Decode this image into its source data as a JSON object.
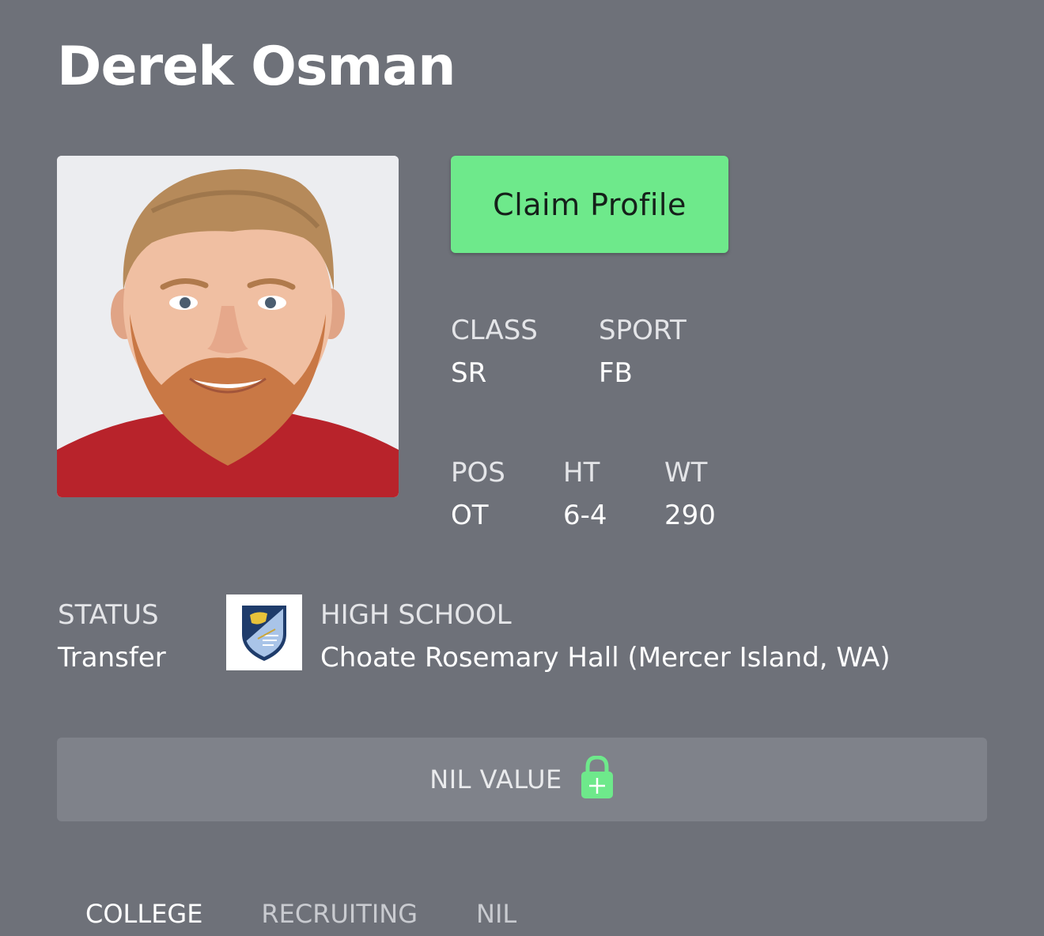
{
  "player": {
    "name": "Derek Osman"
  },
  "claim_button": {
    "label": "Claim Profile"
  },
  "stats": {
    "class": {
      "label": "CLASS",
      "value": "SR"
    },
    "sport": {
      "label": "SPORT",
      "value": "FB"
    },
    "pos": {
      "label": "POS",
      "value": "OT"
    },
    "ht": {
      "label": "HT",
      "value": "6-4"
    },
    "wt": {
      "label": "WT",
      "value": "290"
    },
    "status": {
      "label": "STATUS",
      "value": "Transfer"
    },
    "high_school": {
      "label": "HIGH SCHOOL",
      "value": "Choate Rosemary Hall (Mercer Island, WA)"
    }
  },
  "nil": {
    "label": "NIL VALUE",
    "icon": "lock-plus-icon"
  },
  "tabs": [
    {
      "label": "COLLEGE",
      "active": true
    },
    {
      "label": "RECRUITING",
      "active": false
    },
    {
      "label": "NIL",
      "active": false
    }
  ],
  "colors": {
    "background": "#6e7179",
    "accent_green": "#6ee98b",
    "nil_bar": "#7f828a"
  }
}
